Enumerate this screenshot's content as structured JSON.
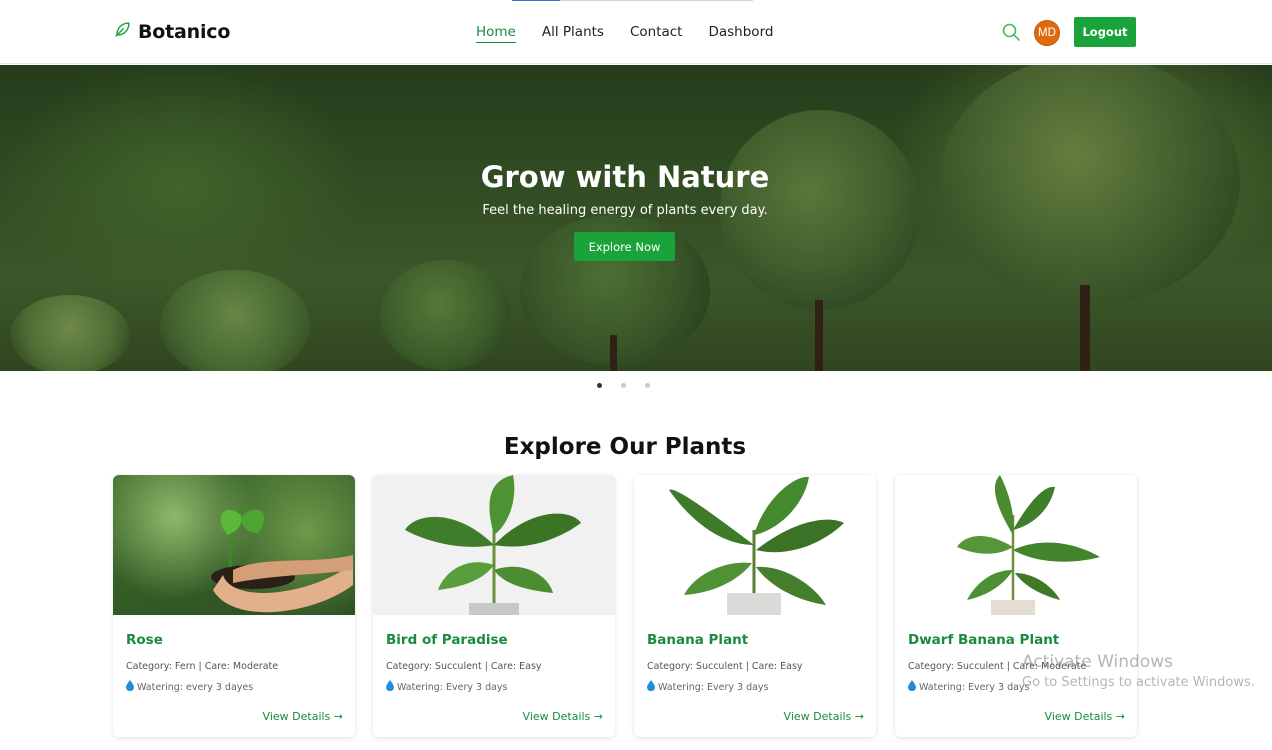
{
  "brand": {
    "name": "Botanico",
    "icon": "leaf-icon",
    "color": "#1aa33a"
  },
  "nav": {
    "links": [
      "Home",
      "All Plants",
      "Contact",
      "Dashbord"
    ],
    "active": "Home"
  },
  "user": {
    "initials": "MD",
    "avatar_color": "#e06a12"
  },
  "actions": {
    "logout_label": "Logout",
    "search_icon": "search-icon"
  },
  "hero": {
    "title": "Grow with Nature",
    "subtitle": "Feel the healing energy of plants every day.",
    "cta_label": "Explore Now",
    "slides": 3,
    "active_slide": 1
  },
  "section": {
    "title": "Explore Our Plants"
  },
  "plants": [
    {
      "name": "Rose",
      "meta": "Category: Fern | Care: Moderate",
      "watering": "Watering: every 3 dayes",
      "link": "View Details →"
    },
    {
      "name": "Bird of Paradise",
      "meta": "Category: Succulent | Care: Easy",
      "watering": "Watering: Every 3 days",
      "link": "View Details →"
    },
    {
      "name": "Banana Plant",
      "meta": "Category: Succulent | Care: Easy",
      "watering": "Watering: Every 3 days",
      "link": "View Details →"
    },
    {
      "name": "Dwarf Banana Plant",
      "meta": "Category: Succulent | Care: Moderate",
      "watering": "Watering: Every 3 days",
      "link": "View Details →"
    }
  ],
  "watermark": {
    "line1": "Activate Windows",
    "line2": "Go to Settings to activate Windows."
  },
  "theme": {
    "accent": "#1aa33a",
    "link_green": "#1a8a3e"
  }
}
